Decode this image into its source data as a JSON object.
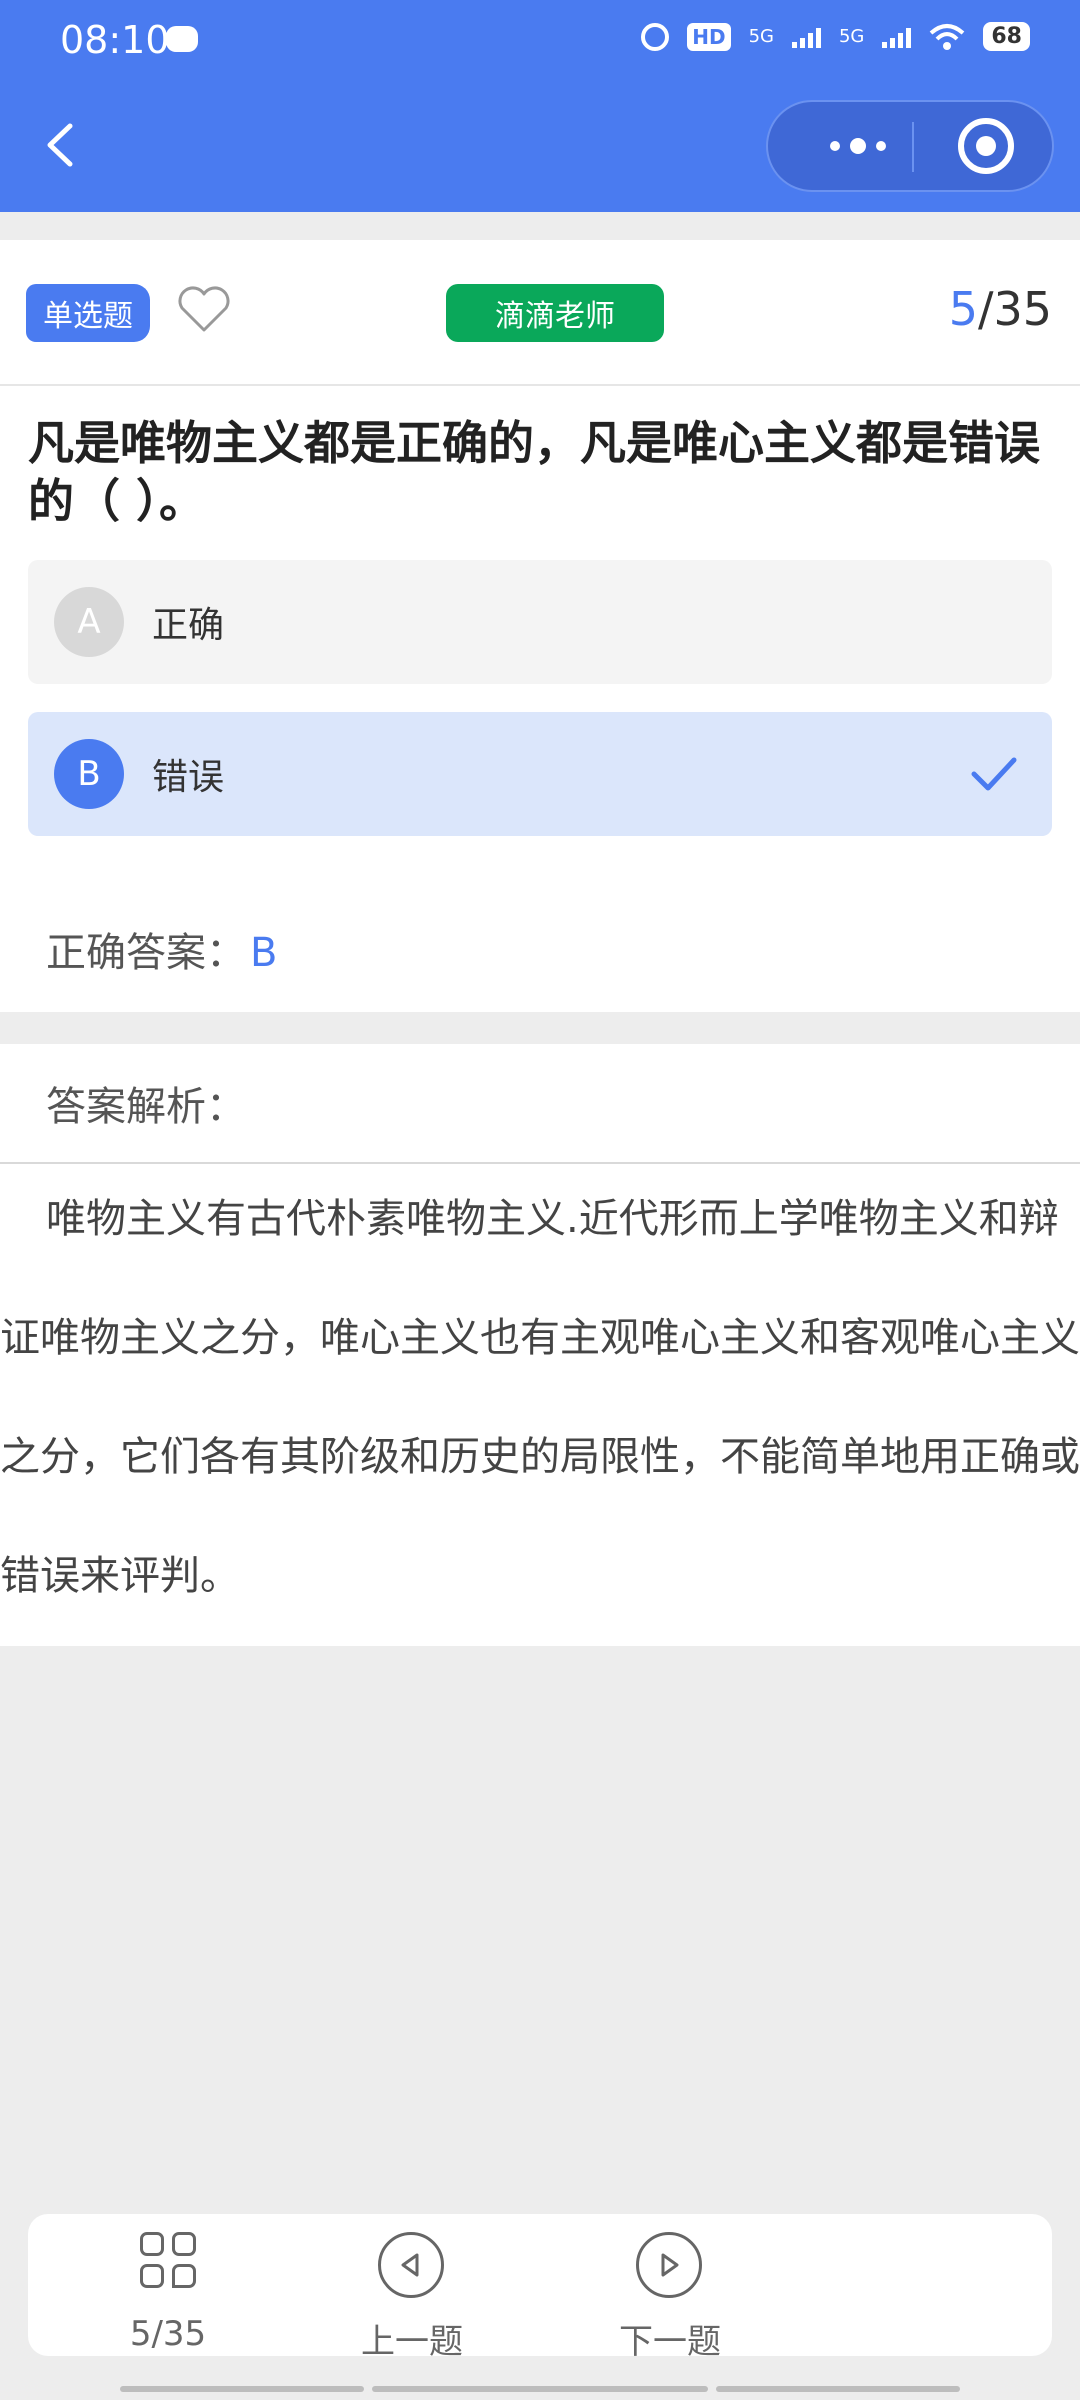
{
  "status_bar": {
    "time": "08:10",
    "hd_label": "HD",
    "signal1": "5G",
    "signal2": "5G",
    "battery": "68"
  },
  "nav": {
    "back_icon": "chevron-left-icon",
    "more_icon": "more-dots-icon",
    "target_icon": "target-icon"
  },
  "question": {
    "type_label": "单选题",
    "teacher_tag": "滴滴老师",
    "progress_current": "5",
    "progress_total": "/35",
    "title": "凡是唯物主义都是正确的，凡是唯心主义都是错误的（ ）。",
    "options": [
      {
        "letter": "A",
        "text": "正确"
      },
      {
        "letter": "B",
        "text": "错误"
      }
    ],
    "answer_label": "正确答案：",
    "answer_value": "B"
  },
  "analysis": {
    "heading": "答案解析：",
    "body": "唯物主义有古代朴素唯物主义.近代形而上学唯物主义和辩证唯物主义之分，唯心主义也有主观唯心主义和客观唯心主义之分，它们各有其阶级和历史的局限性，不能简单地用正确或错误来评判。"
  },
  "bottom_nav": {
    "list_label": "5/35",
    "prev_label": "上一题",
    "next_label": "下一题"
  },
  "colors": {
    "primary": "#4a7bf0",
    "teacher_tag": "#0aa85a",
    "selected_option_bg": "#dbe6fb"
  }
}
